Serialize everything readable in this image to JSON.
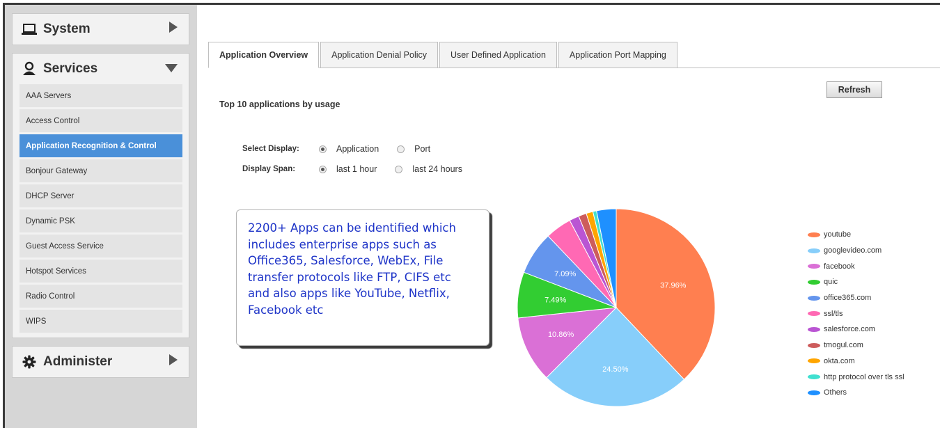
{
  "sidebar": {
    "system": {
      "label": "System",
      "icon": "laptop-icon"
    },
    "services": {
      "label": "Services",
      "icon": "users-icon",
      "items": [
        "AAA Servers",
        "Access Control",
        "Application Recognition & Control",
        "Bonjour Gateway",
        "DHCP Server",
        "Dynamic PSK",
        "Guest Access Service",
        "Hotspot Services",
        "Radio Control",
        "WIPS"
      ],
      "active_item": "Application Recognition & Control"
    },
    "administer": {
      "label": "Administer",
      "icon": "gear-icon"
    }
  },
  "tabs": [
    "Application Overview",
    "Application Denial Policy",
    "User Defined Application",
    "Application Port Mapping"
  ],
  "active_tab": "Application Overview",
  "refresh_label": "Refresh",
  "heading": "Top 10 applications by usage",
  "select_display": {
    "label": "Select Display:",
    "options": [
      "Application",
      "Port"
    ],
    "selected": "Application"
  },
  "display_span": {
    "label": "Display Span:",
    "options": [
      "last 1 hour",
      "last 24 hours"
    ],
    "selected": "last 1 hour"
  },
  "callout_lines": [
    "2200+ Apps can be identified which",
    "includes enterprise apps such as",
    "Office365, Salesforce, WebEx, File",
    "transfer protocols like FTP, CIFS etc",
    "and also apps like YouTube, Netflix,",
    "Facebook etc"
  ],
  "chart_data": {
    "type": "pie",
    "title": "",
    "slices": [
      {
        "name": "youtube",
        "value": 37.96,
        "label": "37.96%",
        "color": "#ff7f50"
      },
      {
        "name": "googlevideo.com",
        "value": 24.5,
        "label": "24.50%",
        "color": "#87cefa"
      },
      {
        "name": "facebook",
        "value": 10.86,
        "label": "10.86%",
        "color": "#da70d6"
      },
      {
        "name": "quic",
        "value": 7.49,
        "label": "7.49%",
        "color": "#32cd32"
      },
      {
        "name": "office365.com",
        "value": 7.09,
        "label": "7.09%",
        "color": "#6495ed"
      },
      {
        "name": "ssl/tls",
        "value": 4.3,
        "label": "",
        "color": "#ff69b4"
      },
      {
        "name": "salesforce.com",
        "value": 1.6,
        "label": "",
        "color": "#ba55d3"
      },
      {
        "name": "tmogul.com",
        "value": 1.3,
        "label": "",
        "color": "#cd5c5c"
      },
      {
        "name": "okta.com",
        "value": 1.1,
        "label": "",
        "color": "#ffa500"
      },
      {
        "name": "http protocol over tls ssl",
        "value": 0.6,
        "label": "",
        "color": "#40e0d0"
      },
      {
        "name": "Others",
        "value": 3.2,
        "label": "",
        "color": "#1e90ff"
      }
    ],
    "legend_position": "right"
  }
}
